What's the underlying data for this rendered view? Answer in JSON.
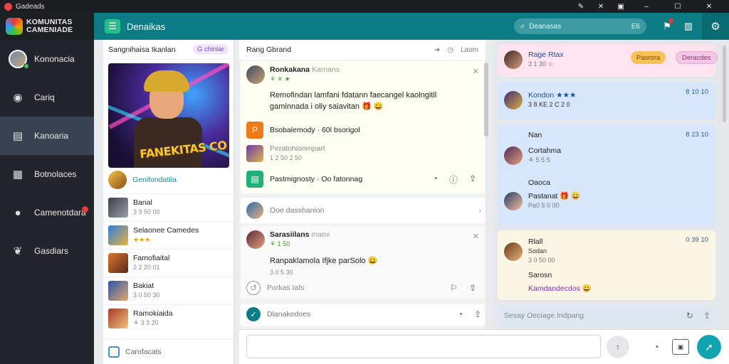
{
  "window": {
    "title": "Gadeads"
  },
  "colors": {
    "accent": "#0e7c84",
    "sidebar": "#22262c",
    "badge": "#e63b3b"
  },
  "brand": {
    "line1": "KOMUNITAS",
    "line2": "CAMENIADE"
  },
  "sidebar": {
    "items": [
      {
        "label": "Kononacia",
        "icon": "user-avatar-icon"
      },
      {
        "label": "Cariq",
        "icon": "camera-icon"
      },
      {
        "label": "Kanoaria",
        "icon": "chat-bubbles-icon"
      },
      {
        "label": "Botnolaces",
        "icon": "inbox-icon"
      },
      {
        "label": "Camenotdara",
        "icon": "users-icon"
      },
      {
        "label": "Gasdiars",
        "icon": "bird-icon"
      }
    ]
  },
  "header": {
    "title": "Denaikas",
    "search_text": "Deanasas",
    "search_hint": "E6"
  },
  "col1": {
    "title": "Sangnihaisa Ikanlan",
    "chip": "G chinlar",
    "hero_text": "FANEKITAS CO",
    "featured": "Genifondatila",
    "users": [
      {
        "name": "Banal",
        "meta": "3 9 50 00",
        "stars": ""
      },
      {
        "name": "Selaonee Camedes",
        "meta": "",
        "stars": "★★★"
      },
      {
        "name": "Famofiaital",
        "meta": "2 2 20 01",
        "stars": ""
      },
      {
        "name": "Bakiat",
        "meta": "3 0 50 30",
        "stars": ""
      },
      {
        "name": "Ramokiaida",
        "meta": "⚘ 3 3 20",
        "stars": ""
      }
    ],
    "footer": "Carofacats"
  },
  "col2": {
    "title": "Rang Gbrand",
    "head_right": "Laom",
    "post1": {
      "author": "Ronkakana",
      "author_sub": "Karnans",
      "status": "⚘ ✕ ★",
      "text": "Remofindan lamfani fdatann faecangel kaolngitil gaminnada i oliy saiavitan 🎁 😀",
      "attach1": "Bsobalemody · 60l bsorigol",
      "attach2": "Peratohionmpart",
      "attach2_meta": "1 2 50 2 50",
      "attach3": "Pastmignosty · Oo fatonnag"
    },
    "row2": "Ooe dasshanion",
    "post2": {
      "author": "Sarasiilans",
      "author_sub": "mami",
      "status": "⚘ 1 50",
      "text": "Ranpaklamola Ifjke parSolo 😀",
      "meta": "3 0 5 30",
      "reply": "Porkas Iafs"
    },
    "row4": "Dlanakedoes"
  },
  "col3": {
    "card1": {
      "name": "Rage Rtax",
      "meta": "3 1 30 ☆",
      "tag1": "Pasrora",
      "tag2": "Deracdes"
    },
    "card2": {
      "name": "Kondon ★★★",
      "meta": "3 8 KE 2 C 2 0",
      "time": "8 10 10"
    },
    "card3": {
      "header": "Nan",
      "time": "8 23 10",
      "line1": "Cortahma",
      "line1_meta": "⚘ 5 5 5",
      "line2": "Oaoca",
      "line3": "Pastanat 🎁 😀",
      "line3_meta": "Pa0 5 0 00"
    },
    "card4": {
      "name": "Rlall",
      "time": "0 39 10",
      "line1": "Sodan",
      "line1_meta": "3 0 50 00",
      "line2": "Sarosn",
      "line3": "Kamdandecdos 😀"
    },
    "card5": "Sesay Oeciage Indpang"
  },
  "composer": {
    "placeholder": ""
  }
}
